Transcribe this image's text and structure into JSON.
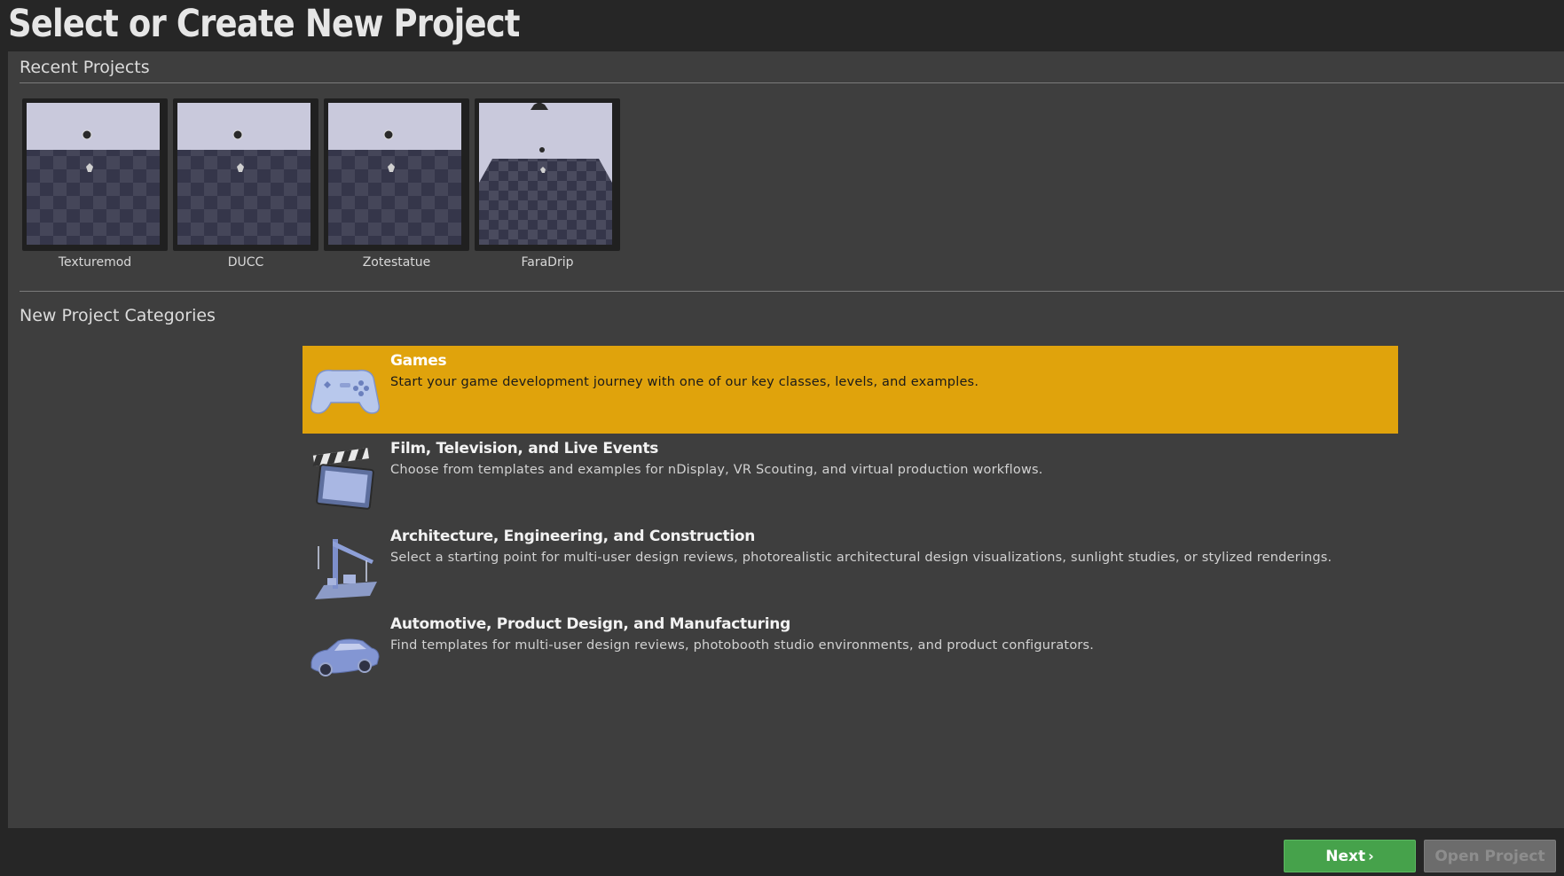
{
  "page_title": "Select or Create New Project",
  "recent": {
    "header": "Recent Projects",
    "projects": [
      {
        "name": "Texturemod"
      },
      {
        "name": "DUCC"
      },
      {
        "name": "Zotestatue"
      },
      {
        "name": "FaraDrip"
      }
    ]
  },
  "categories": {
    "header": "New Project Categories",
    "items": [
      {
        "title": "Games",
        "description": "Start your game development journey with one of our key classes, levels, and examples.",
        "icon": "gamepad-icon",
        "selected": true
      },
      {
        "title": "Film, Television, and Live Events",
        "description": "Choose from templates and examples for nDisplay, VR Scouting, and virtual production workflows.",
        "icon": "clapperboard-icon",
        "selected": false
      },
      {
        "title": "Architecture, Engineering, and Construction",
        "description": "Select a starting point for multi-user design reviews, photorealistic architectural design visualizations, sunlight studies, or stylized renderings.",
        "icon": "crane-icon",
        "selected": false
      },
      {
        "title": "Automotive, Product Design, and Manufacturing",
        "description": "Find templates for multi-user design reviews, photobooth studio environments, and product configurators.",
        "icon": "car-icon",
        "selected": false
      }
    ]
  },
  "footer": {
    "next_label": "Next",
    "open_label": "Open Project"
  },
  "colors": {
    "selected_bg": "#e0a30c",
    "next_button": "#46a24b",
    "panel_bg": "#3e3e3e",
    "window_bg": "#262626"
  }
}
